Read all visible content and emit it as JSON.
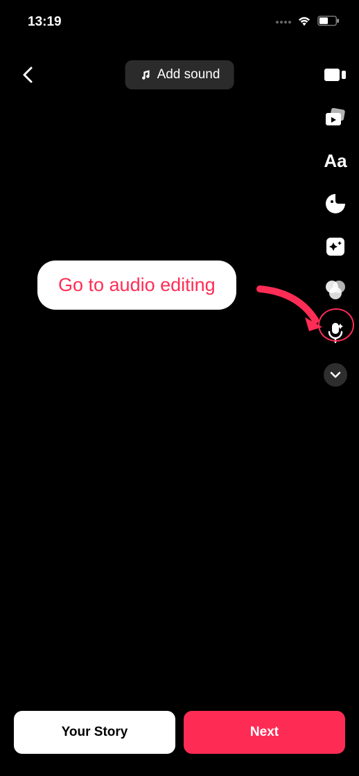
{
  "status": {
    "time": "13:19"
  },
  "topbar": {
    "add_sound_label": "Add sound"
  },
  "annotation": {
    "text": "Go to audio editing"
  },
  "bottom": {
    "story_label": "Your Story",
    "next_label": "Next"
  },
  "side_tools": {
    "adjust": "adjust-clips",
    "templates": "templates",
    "text": "text",
    "stickers": "stickers",
    "effects": "effects",
    "filters": "filters",
    "audio": "audio-editing",
    "more": "more"
  }
}
